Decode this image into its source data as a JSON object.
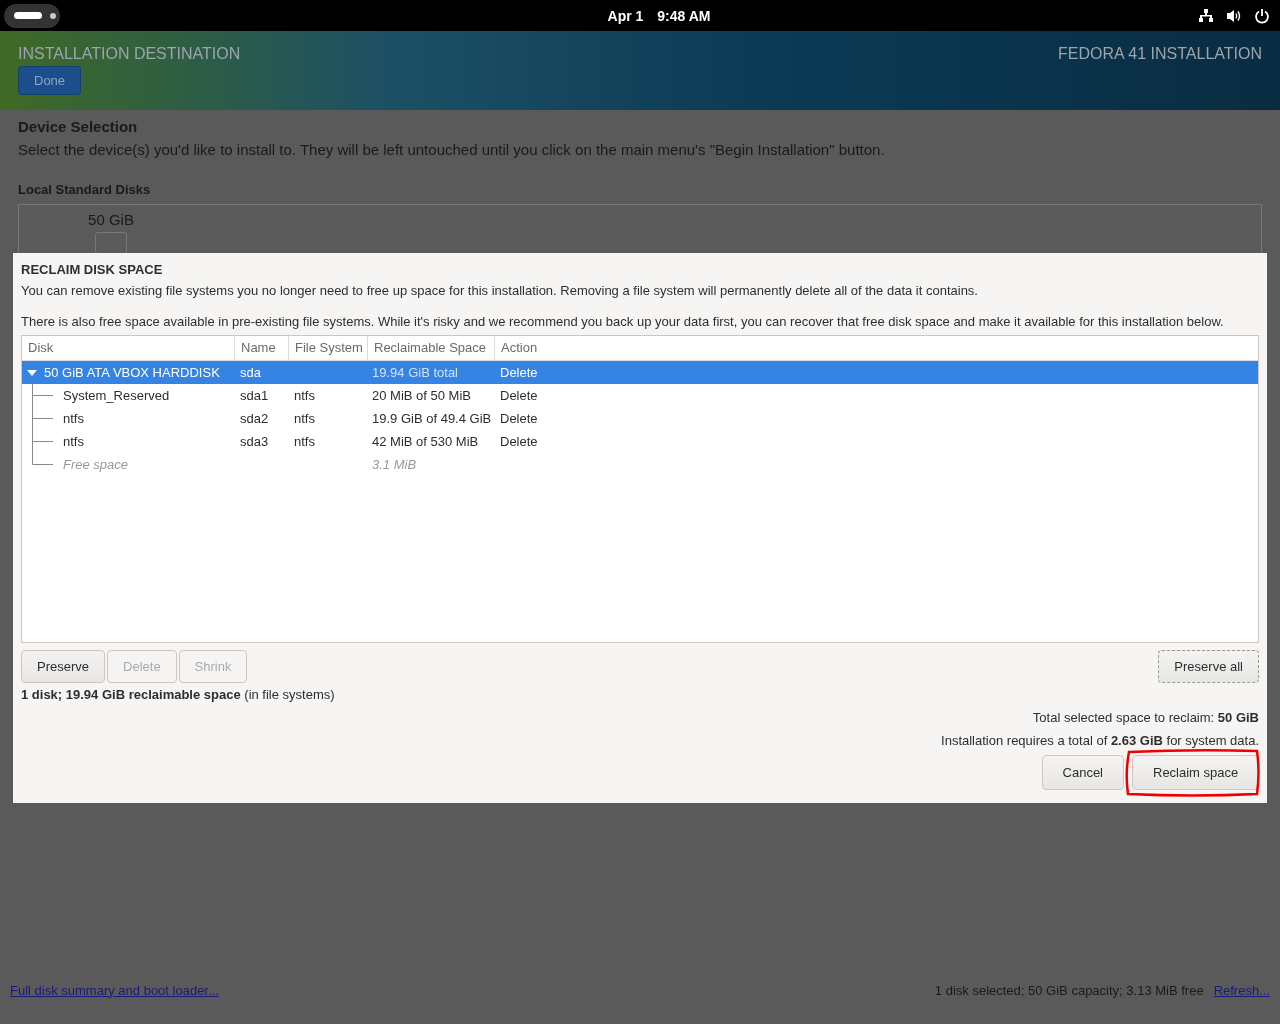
{
  "top_bar": {
    "date": "Apr 1",
    "time": "9:48 AM"
  },
  "header": {
    "title": "INSTALLATION DESTINATION",
    "done_button": "Done",
    "product": "FEDORA 41 INSTALLATION"
  },
  "device_selection": {
    "heading": "Device Selection",
    "description": "Select the device(s) you'd like to install to.  They will be left untouched until you click on the main menu's \"Begin Installation\" button.",
    "local_disks_label": "Local Standard Disks",
    "disk_size": "50 GiB"
  },
  "dialog": {
    "title": "RECLAIM DISK SPACE",
    "intro": "You can remove existing file systems you no longer need to free up space for this installation.  Removing a file system will permanently delete all of the data it contains.",
    "note": "There is also free space available in pre-existing file systems.  While it's risky and we recommend you back up your data first, you can recover that free disk space and make it available for this installation below.",
    "columns": [
      "Disk",
      "Name",
      "File System",
      "Reclaimable Space",
      "Action"
    ],
    "rows": [
      {
        "kind": "disk",
        "disk": "50 GiB ATA VBOX HARDDISK",
        "name": "sda",
        "reclaimable": "19.94 GiB total",
        "action": "Delete",
        "expanded": true,
        "selected": true,
        "children": [
          {
            "kind": "partition",
            "disk": "System_Reserved",
            "name": "sda1",
            "file_system": "ntfs",
            "reclaimable": "20 MiB of 50 MiB",
            "action": "Delete",
            "selected": false
          },
          {
            "kind": "partition",
            "disk": "ntfs",
            "name": "sda2",
            "file_system": "ntfs",
            "reclaimable": "19.9 GiB of 49.4 GiB",
            "action": "Delete",
            "selected": false
          },
          {
            "kind": "partition",
            "disk": "ntfs",
            "name": "sda3",
            "file_system": "ntfs",
            "reclaimable": "42 MiB of 530 MiB",
            "action": "Delete",
            "selected": false
          },
          {
            "kind": "free",
            "disk": "Free space",
            "reclaimable": "3.1 MiB",
            "selected": false
          }
        ]
      }
    ],
    "row_buttons": [
      {
        "label": "Preserve",
        "disabled": false
      },
      {
        "label": "Delete",
        "disabled": true
      },
      {
        "label": "Shrink",
        "disabled": true
      }
    ],
    "preserve_all_button": "Preserve all",
    "summary": "**1 disk; 19.94 GiB reclaimable space** (in file systems)",
    "total_selected": "Total selected space to reclaim: **50 GiB**",
    "requirement": "Installation requires a total of **2.63 GiB** for system data.",
    "cancel_button": "Cancel",
    "reclaim_button": "Reclaim space"
  },
  "footer": {
    "summary_link": "Full disk summary and boot loader...",
    "status": "1 disk selected; 50 GiB capacity; 3.13 MiB free",
    "refresh_link": "Refresh..."
  }
}
